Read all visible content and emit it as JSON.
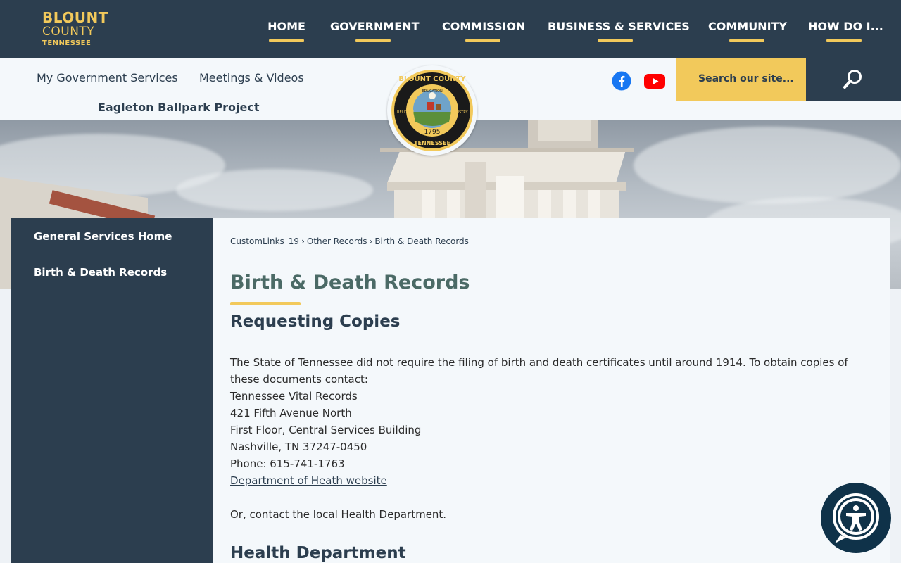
{
  "brand": {
    "line1": "BLOUNT",
    "line2": "COUNTY",
    "line3": "TENNESSEE",
    "accent": "#f2c95b",
    "navy": "#2c3e4f"
  },
  "main_nav": [
    {
      "label": "HOME"
    },
    {
      "label": "GOVERNMENT"
    },
    {
      "label": "COMMISSION"
    },
    {
      "label": "BUSINESS & SERVICES"
    },
    {
      "label": "COMMUNITY"
    },
    {
      "label": "HOW DO I..."
    }
  ],
  "sub_nav": {
    "my_gov": "My Government Services",
    "meetings": "Meetings & Videos",
    "eagleton": "Eagleton Ballpark Project"
  },
  "social": {
    "facebook_icon": "facebook-icon",
    "youtube_icon": "youtube-icon"
  },
  "search": {
    "placeholder": "Search our site...",
    "icon": "search-icon"
  },
  "seal": {
    "top_text": "BLOUNT COUNTY",
    "bottom_text": "TENNESSEE",
    "year": "1795",
    "left_word": "RELIGION",
    "right_word": "INDUSTRY",
    "upper_word": "EDUCATION"
  },
  "sidebar": {
    "items": [
      {
        "label": "General Services Home"
      },
      {
        "label": "Birth & Death Records"
      }
    ]
  },
  "breadcrumb": {
    "items": [
      "CustomLinks_19",
      "Other Records",
      "Birth & Death Records"
    ],
    "sep": "›"
  },
  "page": {
    "title": "Birth & Death Records",
    "section1_heading": "Requesting Copies",
    "intro": "The State of Tennessee did not require the filing of birth and death certificates until around 1914. To obtain copies of these documents contact:",
    "address": [
      "Tennessee Vital Records",
      "421 Fifth Avenue North",
      "First Floor, Central Services Building",
      "Nashville, TN 37247-0450",
      "Phone: 615-741-1763"
    ],
    "link_text": "Department of Heath website",
    "local_note": "Or, contact the local Health Department.",
    "section2_heading": "Health Department"
  },
  "accessibility": {
    "icon": "accessibility-icon"
  }
}
